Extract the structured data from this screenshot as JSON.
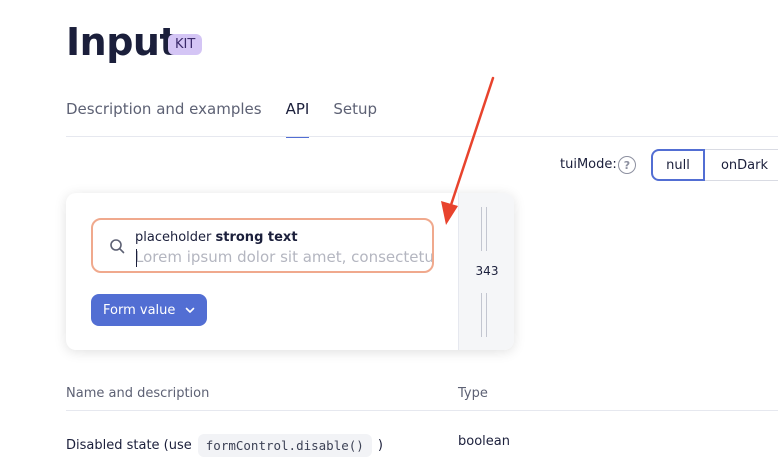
{
  "header": {
    "title": "Input",
    "badge": "KIT"
  },
  "tabs": [
    {
      "label": "Description and examples",
      "active": false
    },
    {
      "label": "API",
      "active": true
    },
    {
      "label": "Setup",
      "active": false
    }
  ],
  "mode": {
    "label": "tuiMode:",
    "help_icon": "question-icon",
    "options": [
      "null",
      "onDark"
    ],
    "selected": "null"
  },
  "demo": {
    "input": {
      "label_regular": "placeholder ",
      "label_bold": "strong text",
      "placeholder": "Lorem ipsum dolor sit amet, consectetur adipiscing",
      "icon": "search-icon",
      "border_color": "#f0a98d"
    },
    "form_button": {
      "label": "Form value",
      "icon": "chevron-down-icon"
    },
    "resize": {
      "width_readout": "343"
    }
  },
  "table": {
    "columns": [
      "Name and description",
      "Type"
    ],
    "rows": [
      {
        "desc_before": "Disabled state (use",
        "code": "formControl.disable()",
        "desc_after": ")",
        "type": "boolean"
      }
    ]
  },
  "colors": {
    "accent": "#526ed3",
    "annotation_arrow": "#e8432d",
    "badge": "#d4c5f5"
  }
}
